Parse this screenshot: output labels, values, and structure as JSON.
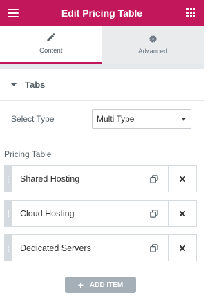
{
  "header": {
    "title": "Edit Pricing Table",
    "menu_icon": "hamburger-icon",
    "apps_icon": "grid-icon",
    "brand_color": "#c2185b"
  },
  "tabs": [
    {
      "label": "Content",
      "icon": "pencil-icon",
      "active": true
    },
    {
      "label": "Advanced",
      "icon": "gear-icon",
      "active": false
    }
  ],
  "section": {
    "title": "Tabs",
    "expanded": true
  },
  "select_type": {
    "label": "Select Type",
    "value": "Multi Type"
  },
  "repeater": {
    "label": "Pricing Table",
    "items": [
      {
        "title": "Shared Hosting"
      },
      {
        "title": "Cloud Hosting"
      },
      {
        "title": "Dedicated Servers"
      }
    ],
    "duplicate_icon": "copy-icon",
    "remove_icon": "close-icon",
    "add_label": "ADD ITEM"
  }
}
